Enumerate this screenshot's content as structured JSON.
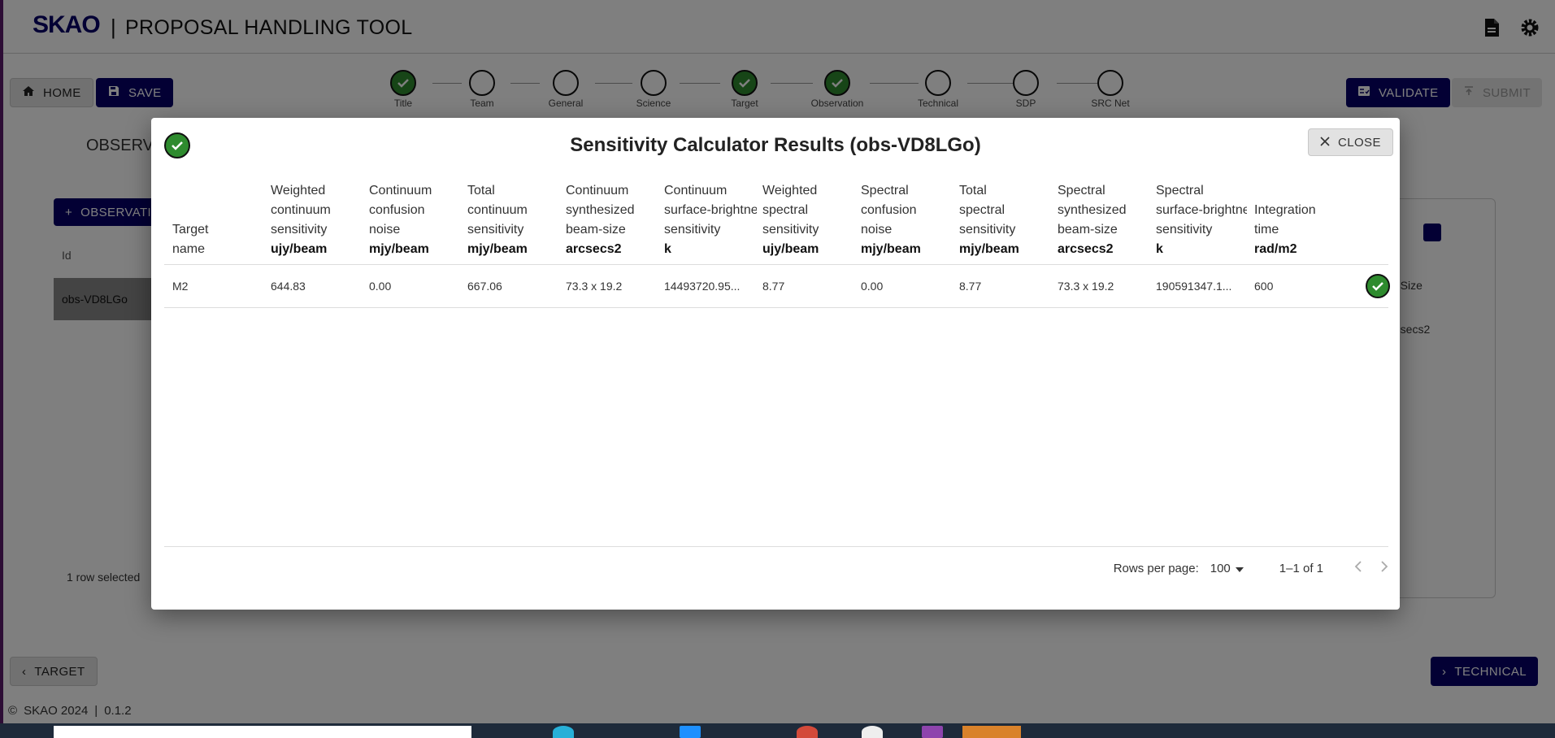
{
  "app": {
    "logo": "SKAO",
    "separator": "|",
    "title": "PROPOSAL HANDLING TOOL"
  },
  "toolbar": {
    "home_label": "HOME",
    "save_label": "SAVE",
    "validate_label": "VALIDATE",
    "submit_label": "SUBMIT"
  },
  "stepper": [
    {
      "label": "Title",
      "done": true
    },
    {
      "label": "Team",
      "done": false
    },
    {
      "label": "General",
      "done": false
    },
    {
      "label": "Science",
      "done": false
    },
    {
      "label": "Target",
      "done": true
    },
    {
      "label": "Observation",
      "done": true
    },
    {
      "label": "Technical",
      "done": false
    },
    {
      "label": "SDP",
      "done": false
    },
    {
      "label": "SRC Net",
      "done": false
    }
  ],
  "page": {
    "section_title": "OBSERV",
    "add_observation_label": "OBSERVATI",
    "id_header": "Id",
    "observation_id": "obs-VD8LGo",
    "right_panel_size": "n Size",
    "right_panel_unit": "rcsecs2",
    "status": "1 row selected",
    "back_label": "TARGET",
    "next_label": "TECHNICAL"
  },
  "footer": {
    "copyright": "SKAO 2024",
    "version": "0.1.2"
  },
  "dialog": {
    "title": "Sensitivity Calculator Results (obs-VD8LGo)",
    "close_label": "CLOSE",
    "columns": [
      {
        "l1": "Target",
        "l2": "name",
        "l3": "",
        "unit": ""
      },
      {
        "l1": "Weighted",
        "l2": "continuum",
        "l3": "sensitivity",
        "unit": "ujy/beam"
      },
      {
        "l1": "Continuum",
        "l2": "confusion",
        "l3": "noise",
        "unit": "mjy/beam"
      },
      {
        "l1": "Total",
        "l2": "continuum",
        "l3": "sensitivity",
        "unit": "mjy/beam"
      },
      {
        "l1": "Continuum",
        "l2": "synthesized",
        "l3": "beam-size",
        "unit": "arcsecs2"
      },
      {
        "l1": "Continuum",
        "l2": "surface-brightne",
        "l3": "sensitivity",
        "unit": "k"
      },
      {
        "l1": "Weighted",
        "l2": "spectral",
        "l3": "sensitivity",
        "unit": "ujy/beam"
      },
      {
        "l1": "Spectral",
        "l2": "confusion",
        "l3": "noise",
        "unit": "mjy/beam"
      },
      {
        "l1": "Total",
        "l2": "spectral",
        "l3": "sensitivity",
        "unit": "mjy/beam"
      },
      {
        "l1": "Spectral",
        "l2": "synthesized",
        "l3": "beam-size",
        "unit": "arcsecs2"
      },
      {
        "l1": "Spectral",
        "l2": "surface-brightne",
        "l3": "sensitivity",
        "unit": "k"
      },
      {
        "l1": "Integration",
        "l2": "time",
        "l3": "",
        "unit": "rad/m2"
      }
    ],
    "rows": [
      [
        "M2",
        "644.83",
        "0.00",
        "667.06",
        "73.3 x 19.2",
        "14493720.95...",
        "8.77",
        "0.00",
        "8.77",
        "73.3 x 19.2",
        "190591347.1...",
        "600"
      ]
    ],
    "rows_per_page_label": "Rows per page:",
    "rows_per_page": "100",
    "range": "1–1 of 1"
  },
  "colors": {
    "brand_navy": "#070068",
    "success_green": "#2e8b2e"
  },
  "icons": [
    "home-icon",
    "save-icon",
    "validate-icon",
    "submit-icon",
    "document-icon",
    "settings-icon",
    "close-icon",
    "check-circle-icon",
    "plus-icon",
    "chevron-left-icon",
    "chevron-right-icon",
    "caret-down-icon",
    "copyright-icon"
  ]
}
